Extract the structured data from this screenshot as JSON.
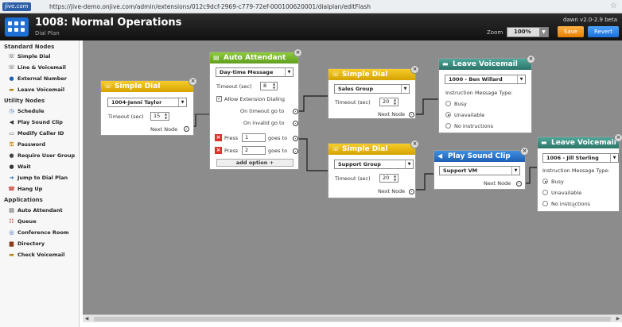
{
  "browser": {
    "site_badge": "jive.com",
    "url": "https://jive-demo.onjive.com/admin/extensions/012c9dcf-2969-c779-72ef-000100620001/dialplan/editFlash",
    "star": "☆"
  },
  "header": {
    "title": "1008: Normal Operations",
    "subtitle": "Dial Plan",
    "version": "dawn v2.0-2.9 beta",
    "zoom_label": "Zoom",
    "zoom_value": "100%",
    "save_label": "Save",
    "revert_label": "Revert"
  },
  "sidebar": {
    "sections": [
      {
        "title": "Standard Nodes",
        "items": [
          {
            "label": "Simple Dial",
            "icon": "phone-icon"
          },
          {
            "label": "Line & Voicemail",
            "icon": "phone-icon"
          },
          {
            "label": "External Number",
            "icon": "globe-icon"
          },
          {
            "label": "Leave Voicemail",
            "icon": "voicemail-icon"
          }
        ]
      },
      {
        "title": "Utility Nodes",
        "items": [
          {
            "label": "Schedule",
            "icon": "clock-icon"
          },
          {
            "label": "Play Sound Clip",
            "icon": "speaker-icon"
          },
          {
            "label": "Modify Caller ID",
            "icon": "id-card-icon"
          },
          {
            "label": "Password",
            "icon": "key-icon"
          },
          {
            "label": "Require User Group",
            "icon": "users-icon"
          },
          {
            "label": "Wait",
            "icon": "clock-icon"
          },
          {
            "label": "Jump to Dial Plan",
            "icon": "arrow-icon"
          },
          {
            "label": "Hang Up",
            "icon": "hangup-icon"
          }
        ]
      },
      {
        "title": "Applications",
        "items": [
          {
            "label": "Auto Attendant",
            "icon": "menu-icon"
          },
          {
            "label": "Queue",
            "icon": "queue-icon"
          },
          {
            "label": "Conference Room",
            "icon": "conference-icon"
          },
          {
            "label": "Directory",
            "icon": "book-icon"
          },
          {
            "label": "Check Voicemail",
            "icon": "voicemail-icon"
          }
        ]
      }
    ]
  },
  "nodes": {
    "simple_dial_1": {
      "title": "Simple Dial",
      "select": "1004-Jenni Taylor",
      "timeout_label": "Timeout (sec)",
      "timeout": "15",
      "next_label": "Next Node"
    },
    "auto_attendant": {
      "title": "Auto Attendant",
      "select": "Day-time Message",
      "timeout_label": "Timeout (sec)",
      "timeout": "8",
      "checkbox_label": "Allow Extension Dialing",
      "on_timeout": "On timeout go to",
      "on_invalid": "On invalid go to",
      "press_label": "Press",
      "goes_to": "goes to",
      "press_1": "1",
      "press_2": "2",
      "add_option": "add option +"
    },
    "simple_dial_2": {
      "title": "Simple Dial",
      "select": "Sales Group",
      "timeout_label": "Timeout (sec)",
      "timeout": "20",
      "next_label": "Next Node"
    },
    "simple_dial_3": {
      "title": "Simple Dial",
      "select": "Support Group",
      "timeout_label": "Timeout (sec)",
      "timeout": "20",
      "next_label": "Next Node"
    },
    "leave_voicemail_1": {
      "title": "Leave Voicemail",
      "select": "1000 - Ben Willard",
      "type_label": "Instruction Message Type:",
      "options": [
        "Busy",
        "Unavailable",
        "No instructions"
      ],
      "selected": 1
    },
    "play_sound_clip": {
      "title": "Play Sound Clip",
      "select": "Support VM",
      "next_label": "Next Node"
    },
    "leave_voicemail_2": {
      "title": "Leave Voicemail",
      "select": "1006 - Jill Sterling",
      "type_label": "Instruction Message Type:",
      "options": [
        "Busy",
        "Unavailable",
        "No instructions"
      ],
      "selected": 0
    }
  },
  "colors": {
    "simple_dial": "#e6b812",
    "auto_attendant": "#76b52e",
    "leave_voicemail": "#3a8c80",
    "play_sound_clip": "#2f7bd0",
    "save": "#f39200",
    "revert": "#2b86ec"
  }
}
